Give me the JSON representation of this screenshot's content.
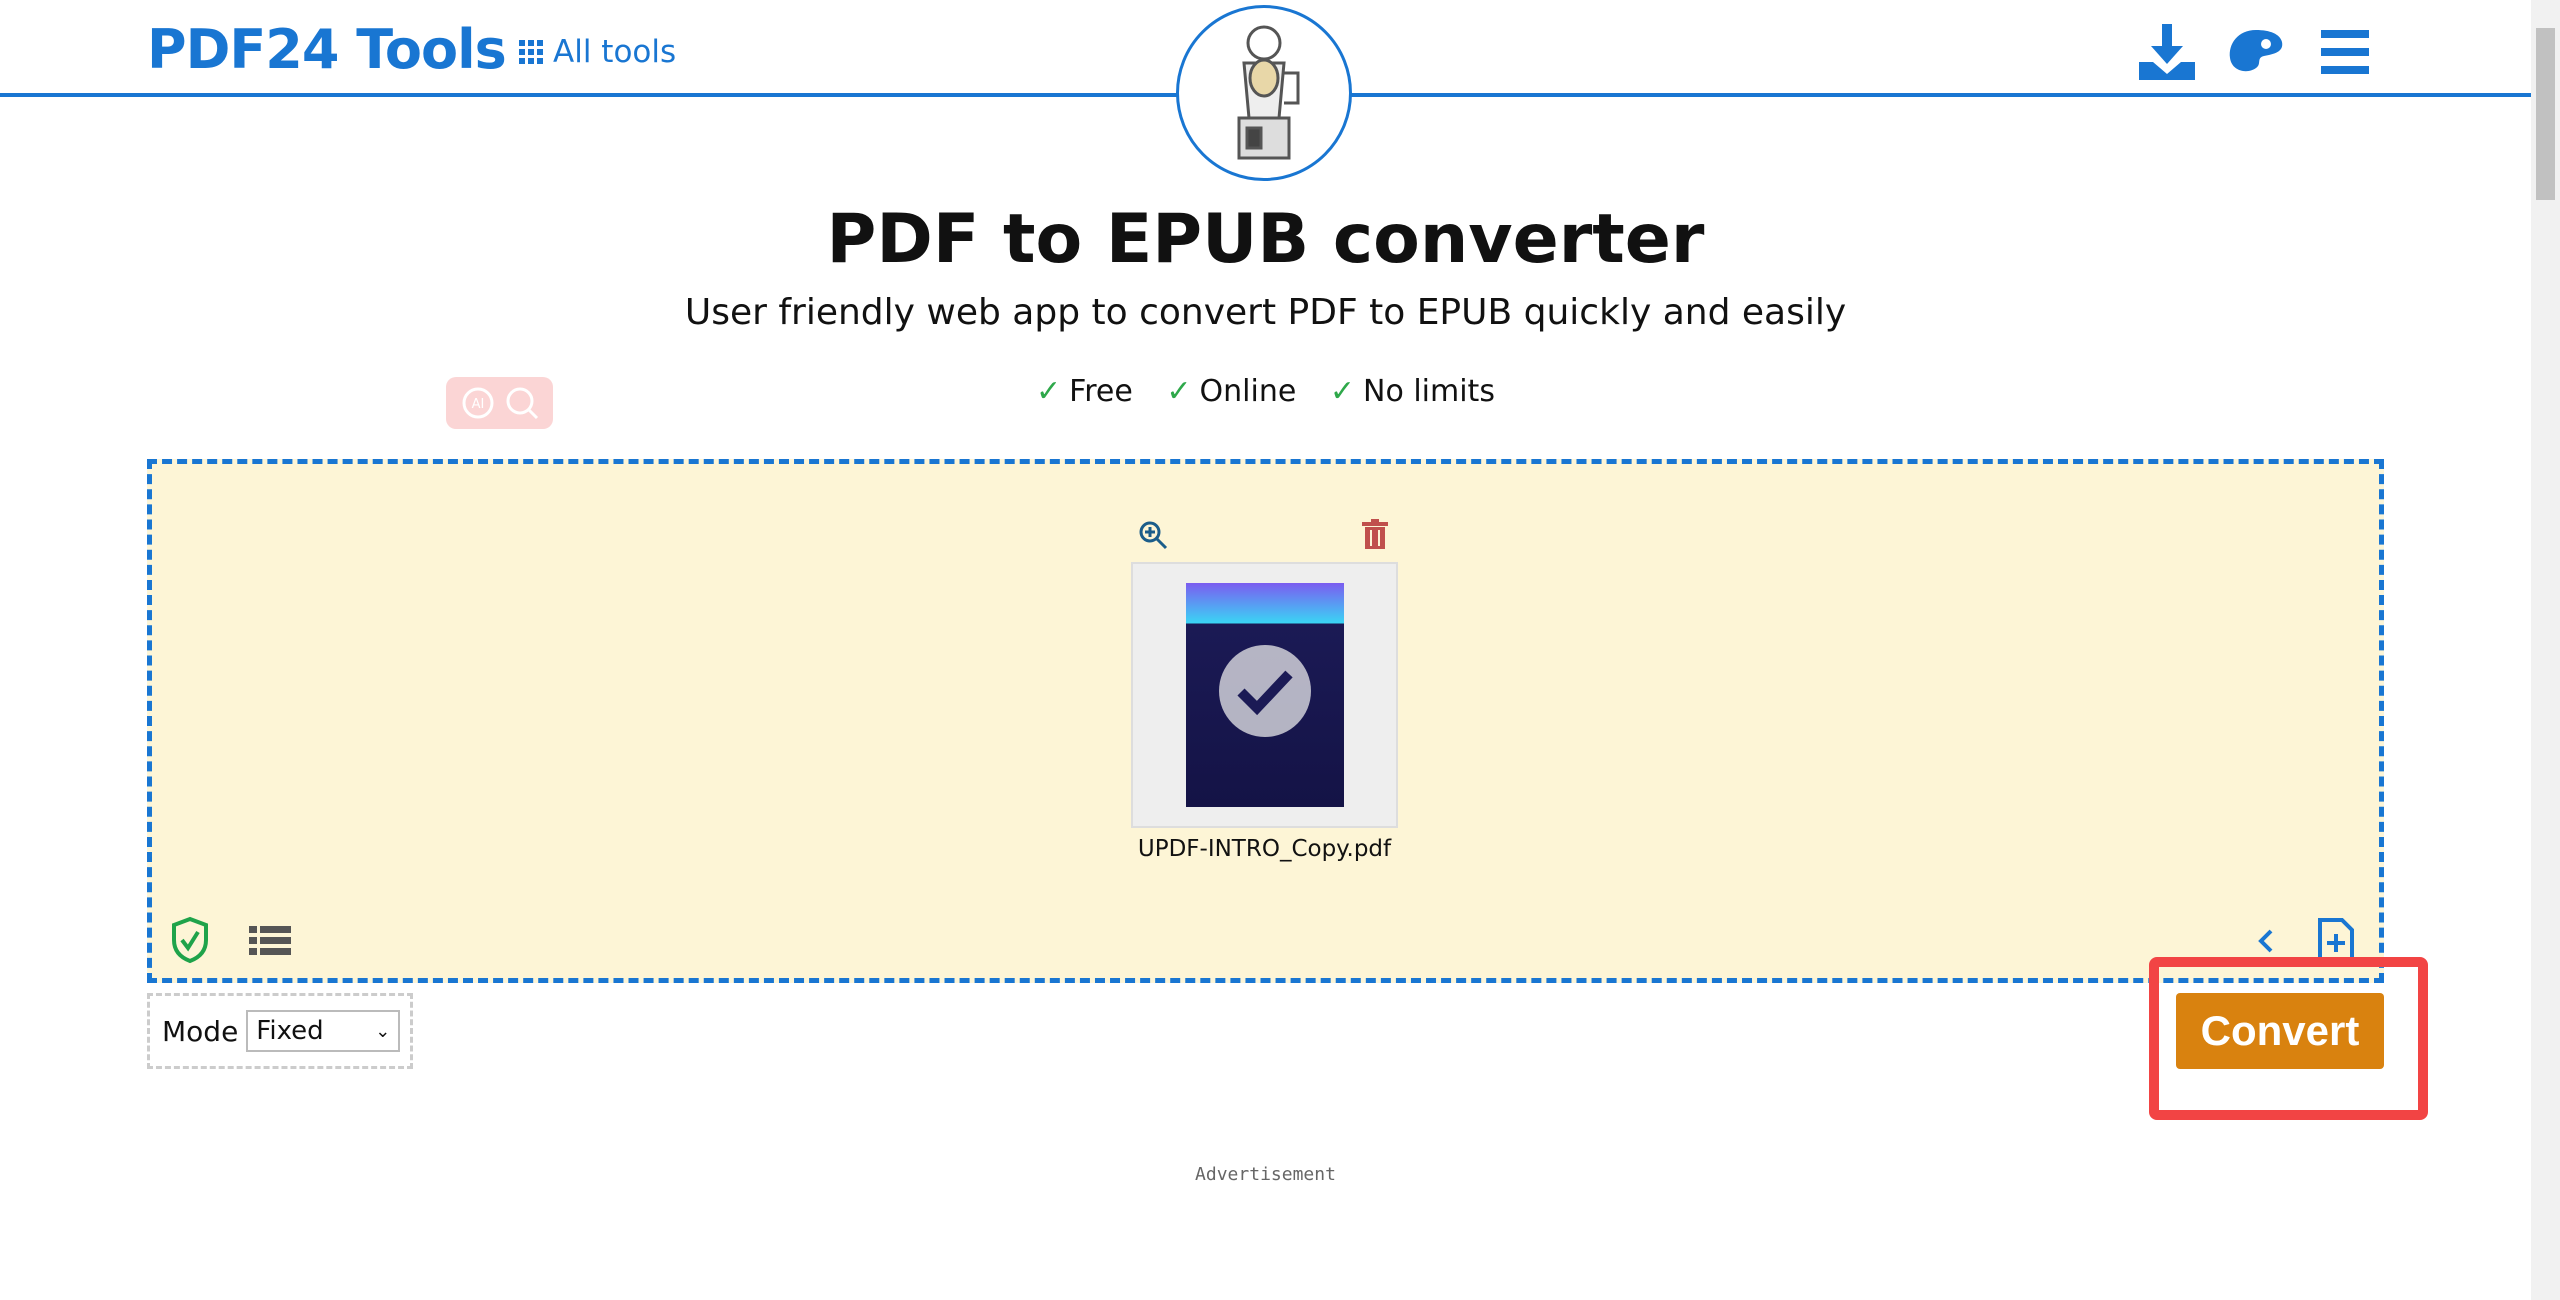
{
  "header": {
    "logo": "PDF24 Tools",
    "all_tools": "All tools",
    "icons": [
      "download-icon",
      "palette-icon",
      "menu-icon"
    ]
  },
  "hero": {
    "title": "PDF to EPUB converter",
    "subtitle": "User friendly web app to convert PDF to EPUB quickly and easily",
    "features": [
      "Free",
      "Online",
      "No limits"
    ]
  },
  "file": {
    "name": "UPDF-INTRO_Copy.pdf"
  },
  "options": {
    "mode_label": "Mode",
    "mode_value": "Fixed"
  },
  "actions": {
    "convert": "Convert"
  },
  "ad": {
    "label": "Advertisement"
  },
  "colors": {
    "brand": "#1976d2",
    "convert": "#d9820f",
    "highlight": "#f24444",
    "dropzone": "#fdf5d6"
  }
}
